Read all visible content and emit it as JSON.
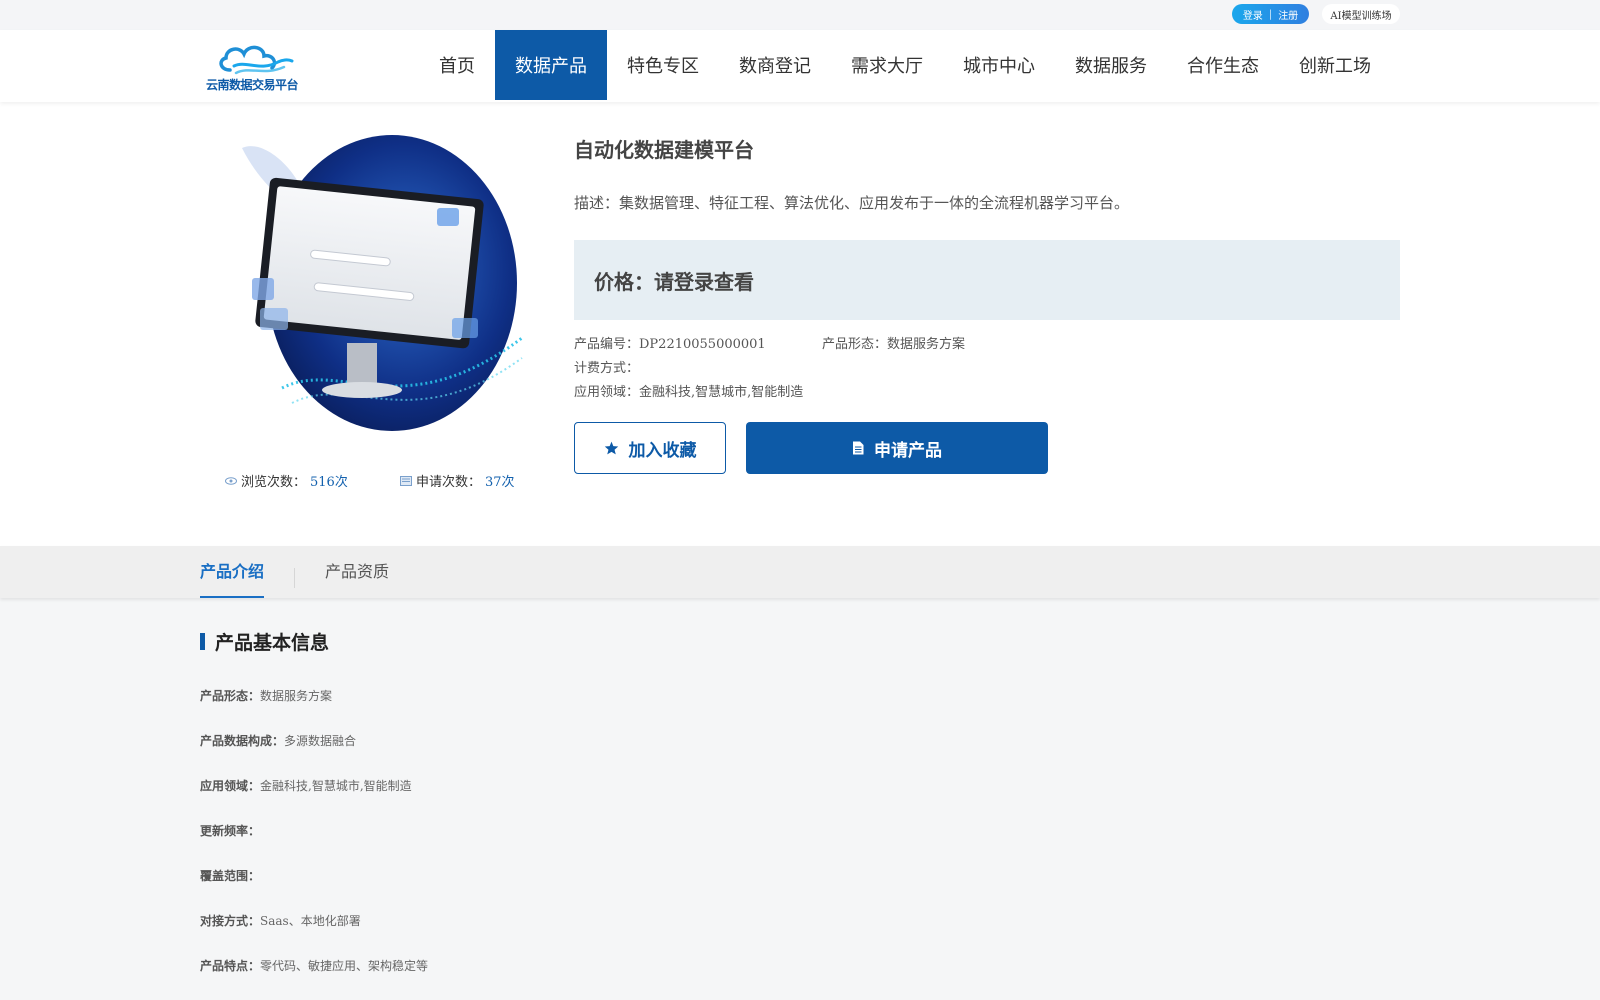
{
  "topbar": {
    "login": "登录",
    "sep": "|",
    "register": "注册",
    "ai_link": "AI模型训练场"
  },
  "header": {
    "logo_text": "云南数据交易平台",
    "nav": [
      "首页",
      "数据产品",
      "特色专区",
      "数商登记",
      "需求大厅",
      "城市中心",
      "数据服务",
      "合作生态",
      "创新工场"
    ],
    "active_nav": "数据产品"
  },
  "product": {
    "title": "自动化数据建模平台",
    "description": "描述：集数据管理、特征工程、算法优化、应用发布于一体的全流程机器学习平台。",
    "price": "价格：请登录查看",
    "code": "产品编号：DP2210055000001",
    "form": "产品形态：数据服务方案",
    "billing": "计费方式：",
    "domain": "应用领域：金融科技,智慧城市,智能制造",
    "fav_button": "加入收藏",
    "apply_button": "申请产品",
    "views_label": "浏览次数：",
    "views_value": "516次",
    "apps_label": "申请次数：",
    "apps_value": "37次"
  },
  "tabs": {
    "intro": "产品介绍",
    "qualification": "产品资质"
  },
  "basic_info": {
    "title": "产品基本信息",
    "rows": [
      {
        "label": "产品形态：",
        "value": "数据服务方案"
      },
      {
        "label": "产品数据构成：",
        "value": "多源数据融合"
      },
      {
        "label": "应用领域：",
        "value": "金融科技,智慧城市,智能制造"
      },
      {
        "label": "更新频率：",
        "value": ""
      },
      {
        "label": "覆盖范围：",
        "value": ""
      },
      {
        "label": "对接方式：",
        "value": "Saas、本地化部署"
      },
      {
        "label": "产品特点：",
        "value": "零代码、敏捷应用、架构稳定等"
      }
    ]
  },
  "colors": {
    "brand": "#0d5aa7",
    "price_bg": "#e6eef3",
    "tab_active": "#1a6fc4"
  }
}
